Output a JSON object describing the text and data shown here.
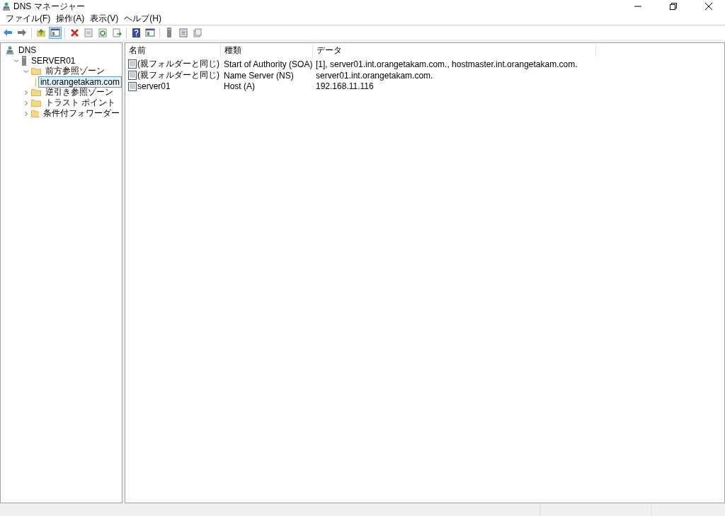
{
  "window": {
    "title": "DNS マネージャー"
  },
  "menu": [
    "ファイル(F)",
    "操作(A)",
    "表示(V)",
    "ヘルプ(H)"
  ],
  "toolbar": [
    {
      "kind": "back",
      "pressed": false
    },
    {
      "kind": "forward",
      "pressed": false
    },
    {
      "kind": "sep"
    },
    {
      "kind": "up",
      "pressed": false
    },
    {
      "kind": "pane",
      "pressed": true
    },
    {
      "kind": "sep"
    },
    {
      "kind": "delete",
      "pressed": false
    },
    {
      "kind": "props",
      "pressed": false
    },
    {
      "kind": "refresh",
      "pressed": false
    },
    {
      "kind": "export",
      "pressed": false
    },
    {
      "kind": "sep"
    },
    {
      "kind": "help",
      "pressed": false
    },
    {
      "kind": "pane",
      "pressed": false
    },
    {
      "kind": "sep"
    },
    {
      "kind": "server",
      "pressed": false
    },
    {
      "kind": "list",
      "pressed": false
    },
    {
      "kind": "copy",
      "pressed": false
    }
  ],
  "tree": [
    {
      "label": "DNS",
      "kind": "dns",
      "selected": false,
      "children": [
        {
          "label": "SERVER01",
          "kind": "server",
          "expanded": true,
          "selected": false,
          "children": [
            {
              "label": "前方参照ゾーン",
              "kind": "folder",
              "expanded": true,
              "selected": false,
              "children": [
                {
                  "label": "int.orangetakam.com",
                  "kind": "zone",
                  "selected": true
                }
              ]
            },
            {
              "label": "逆引き参照ゾーン",
              "kind": "folder",
              "expanded": false,
              "selected": false
            },
            {
              "label": "トラスト ポイント",
              "kind": "folder",
              "expanded": false,
              "selected": false
            },
            {
              "label": "条件付フォワーダー",
              "kind": "folder",
              "expanded": false,
              "selected": false
            }
          ]
        }
      ]
    }
  ],
  "table": {
    "columns": [
      "名前",
      "種類",
      "データ"
    ],
    "rows": [
      [
        "(親フォルダーと同じ)",
        "Start of Authority (SOA)",
        "[1], server01.int.orangetakam.com., hostmaster.int.orangetakam.com."
      ],
      [
        "(親フォルダーと同じ)",
        "Name Server (NS)",
        "server01.int.orangetakam.com."
      ],
      [
        "server01",
        "Host (A)",
        "192.168.11.116"
      ]
    ]
  }
}
